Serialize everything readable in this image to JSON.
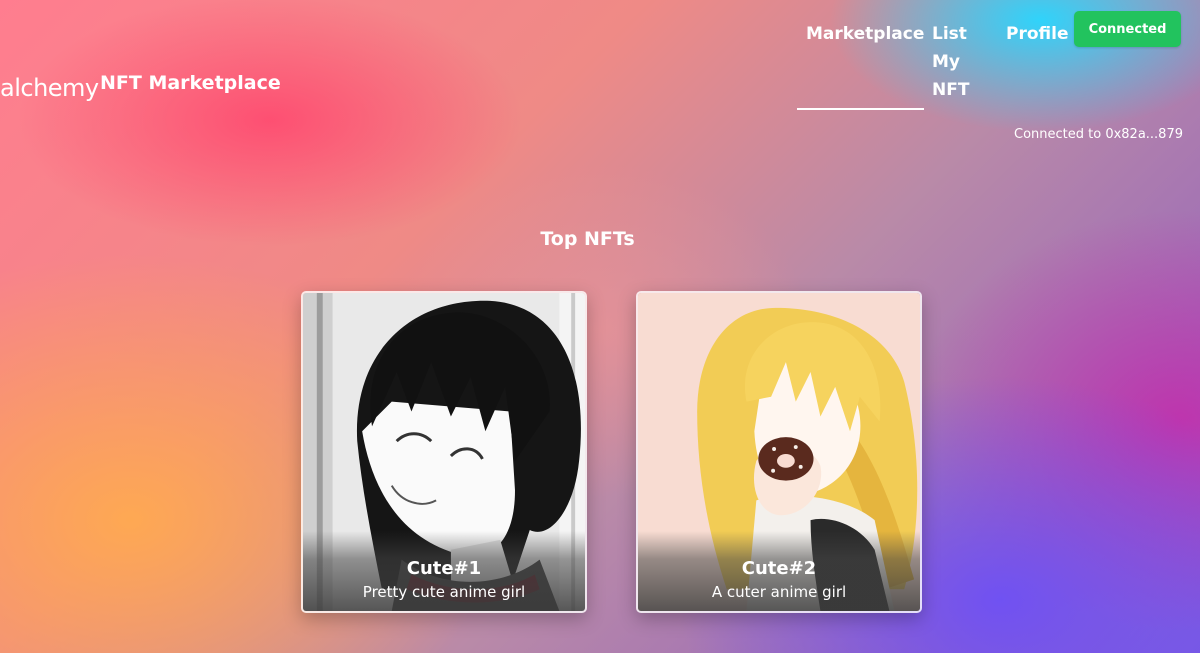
{
  "header": {
    "logo_text": "alchemy",
    "title": "NFT Marketplace",
    "nav": {
      "marketplace": "Marketplace",
      "list_line1": "List",
      "list_line2": "My",
      "list_line3": "NFT",
      "profile": "Profile"
    },
    "connect_button": "Connected",
    "connected_to": "Connected to 0x82a...879"
  },
  "main": {
    "section_title": "Top NFTs",
    "cards": [
      {
        "name": "Cute#1",
        "description": "Pretty cute anime girl",
        "art_icon": "dark-haired-anime-girl-image"
      },
      {
        "name": "Cute#2",
        "description": "A cuter anime girl",
        "art_icon": "blonde-anime-girl-donut-image"
      }
    ]
  },
  "colors": {
    "connect_button_bg": "#22c35e",
    "text": "#ffffff"
  }
}
